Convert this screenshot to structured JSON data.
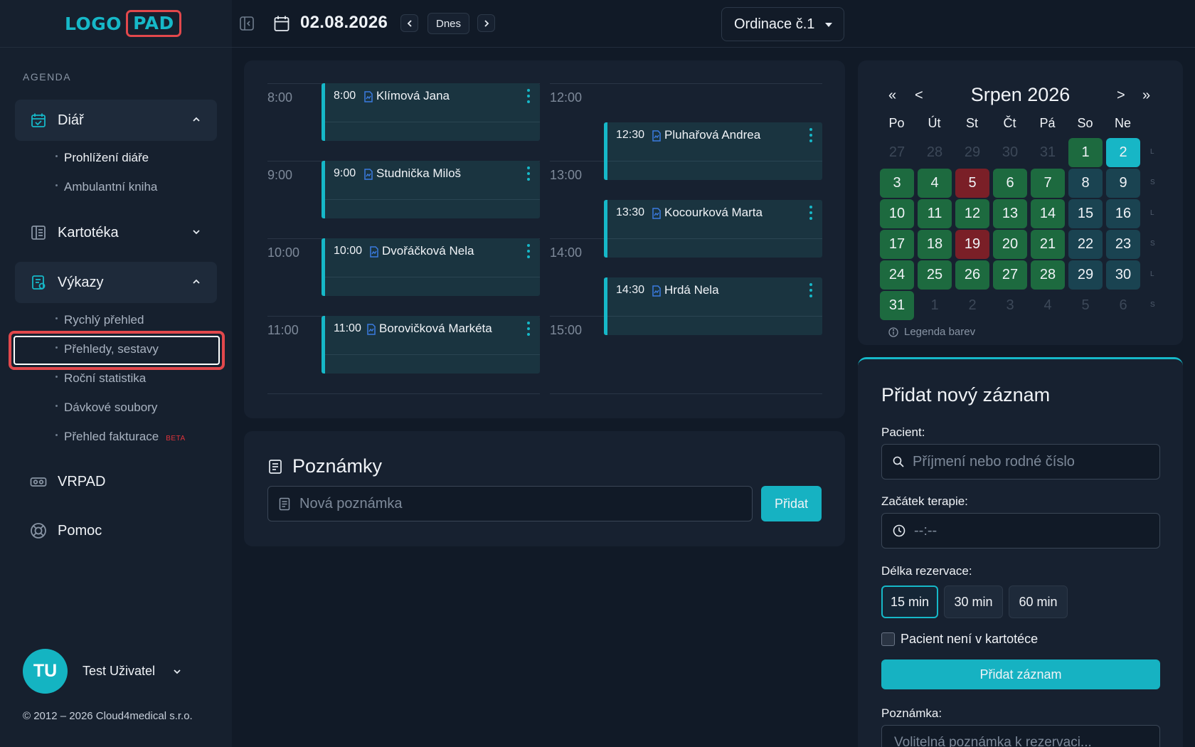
{
  "logo": {
    "part1": "LOGO",
    "part2": "PAD"
  },
  "sidebar": {
    "section_label": "AGENDA",
    "diar": {
      "label": "Diář",
      "items": [
        "Prohlížení diáře",
        "Ambulantní kniha"
      ]
    },
    "kartoteka": {
      "label": "Kartotéka"
    },
    "vykazy": {
      "label": "Výkazy",
      "items": [
        "Rychlý přehled",
        "Přehledy, sestavy",
        "Roční statistika",
        "Dávkové soubory",
        "Přehled fakturace"
      ],
      "beta": "BETA"
    },
    "vrpad": {
      "label": "VRPAD"
    },
    "pomoc": {
      "label": "Pomoc"
    },
    "user": {
      "initials": "TU",
      "name": "Test Uživatel"
    },
    "copyright": "© 2012 – 2026 Cloud4medical s.r.o."
  },
  "topbar": {
    "date": "02.08.2026",
    "today": "Dnes",
    "ordinace": "Ordinace č.1"
  },
  "schedule": {
    "left_hours": [
      "8:00",
      "9:00",
      "10:00",
      "11:00"
    ],
    "right_hours": [
      "12:00",
      "13:00",
      "14:00",
      "15:00"
    ],
    "left_appointments": [
      {
        "time": "8:00",
        "name": "Klímová Jana"
      },
      {
        "time": "9:00",
        "name": "Studnička Miloš"
      },
      {
        "time": "10:00",
        "name": "Dvořáčková Nela"
      },
      {
        "time": "11:00",
        "name": "Borovičková Markéta"
      }
    ],
    "right_appointments": [
      {
        "time": "12:30",
        "name": "Pluhařová Andrea"
      },
      {
        "time": "13:30",
        "name": "Kocourková Marta"
      },
      {
        "time": "14:30",
        "name": "Hrdá Nela"
      }
    ]
  },
  "notes": {
    "title": "Poznámky",
    "placeholder": "Nová poznámka",
    "add": "Přidat"
  },
  "calendar": {
    "prev_year": "«",
    "prev_month": "<",
    "next_month": ">",
    "next_year": "»",
    "title": "Srpen 2026",
    "weekdays": [
      "Po",
      "Út",
      "St",
      "Čt",
      "Pá",
      "So",
      "Ne"
    ],
    "weeks": [
      [
        {
          "d": "27",
          "s": "out"
        },
        {
          "d": "28",
          "s": "out"
        },
        {
          "d": "29",
          "s": "out"
        },
        {
          "d": "30",
          "s": "out"
        },
        {
          "d": "31",
          "s": "out"
        },
        {
          "d": "1",
          "s": "green"
        },
        {
          "d": "2",
          "s": "sel"
        }
      ],
      [
        {
          "d": "3",
          "s": "green"
        },
        {
          "d": "4",
          "s": "green"
        },
        {
          "d": "5",
          "s": "red"
        },
        {
          "d": "6",
          "s": "green"
        },
        {
          "d": "7",
          "s": "green"
        },
        {
          "d": "8",
          "s": "teal"
        },
        {
          "d": "9",
          "s": "teal"
        }
      ],
      [
        {
          "d": "10",
          "s": "green"
        },
        {
          "d": "11",
          "s": "green"
        },
        {
          "d": "12",
          "s": "green"
        },
        {
          "d": "13",
          "s": "green"
        },
        {
          "d": "14",
          "s": "green"
        },
        {
          "d": "15",
          "s": "teal"
        },
        {
          "d": "16",
          "s": "teal"
        }
      ],
      [
        {
          "d": "17",
          "s": "green"
        },
        {
          "d": "18",
          "s": "green"
        },
        {
          "d": "19",
          "s": "red"
        },
        {
          "d": "20",
          "s": "green"
        },
        {
          "d": "21",
          "s": "green"
        },
        {
          "d": "22",
          "s": "teal"
        },
        {
          "d": "23",
          "s": "teal"
        }
      ],
      [
        {
          "d": "24",
          "s": "green"
        },
        {
          "d": "25",
          "s": "green"
        },
        {
          "d": "26",
          "s": "green"
        },
        {
          "d": "27",
          "s": "green"
        },
        {
          "d": "28",
          "s": "green"
        },
        {
          "d": "29",
          "s": "teal"
        },
        {
          "d": "30",
          "s": "teal"
        }
      ],
      [
        {
          "d": "31",
          "s": "green"
        },
        {
          "d": "1",
          "s": "out"
        },
        {
          "d": "2",
          "s": "out"
        },
        {
          "d": "3",
          "s": "out"
        },
        {
          "d": "4",
          "s": "out"
        },
        {
          "d": "5",
          "s": "out"
        },
        {
          "d": "6",
          "s": "out"
        }
      ]
    ],
    "week_markers": [
      "L",
      "S",
      "L",
      "S",
      "L",
      "S"
    ],
    "legend": "Legenda barev"
  },
  "form": {
    "title": "Přidat nový záznam",
    "patient_label": "Pacient:",
    "patient_placeholder": "Příjmení nebo rodné číslo",
    "start_label": "Začátek terapie:",
    "start_placeholder": "--:--",
    "duration_label": "Délka rezervace:",
    "durations": [
      "15 min",
      "30 min",
      "60 min"
    ],
    "checkbox_label": "Pacient není v kartotéce",
    "submit": "Přidat záznam",
    "note_label": "Poznámka:",
    "note_placeholder": "Volitelná poznámka k rezervaci..."
  }
}
